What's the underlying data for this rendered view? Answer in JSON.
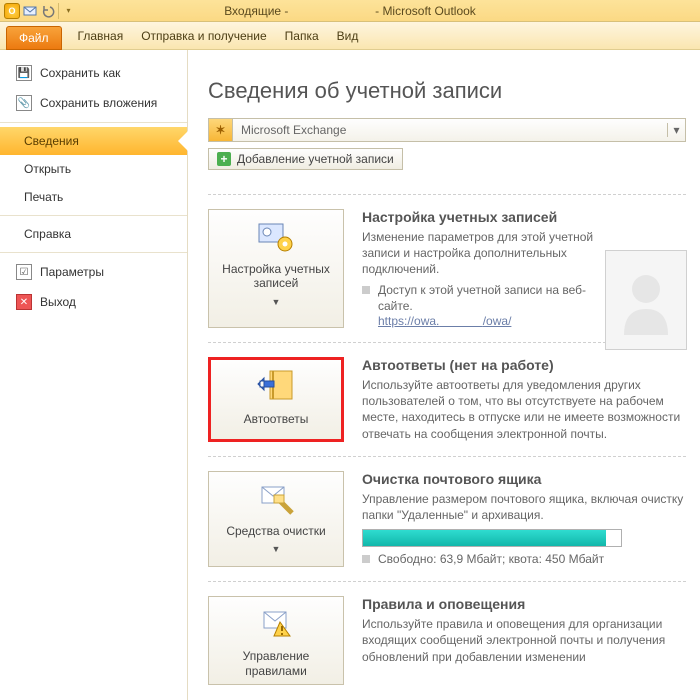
{
  "titlebar": {
    "inbox": "Входящие -",
    "app": "- Microsoft Outlook"
  },
  "tabs": {
    "file": "Файл",
    "home": "Главная",
    "sendrecv": "Отправка и получение",
    "folder": "Папка",
    "view": "Вид"
  },
  "sidebar": {
    "save_as": "Сохранить как",
    "save_attachments": "Сохранить вложения",
    "info": "Сведения",
    "open": "Открыть",
    "print": "Печать",
    "help": "Справка",
    "options": "Параметры",
    "exit": "Выход"
  },
  "content": {
    "heading": "Сведения об учетной записи",
    "account": "Microsoft Exchange",
    "add_account": "Добавление учетной записи",
    "sec1": {
      "button": "Настройка учетных записей",
      "title": "Настройка учетных записей",
      "text": "Изменение параметров для этой учетной записи и настройка дополнительных подключений.",
      "bullet": "Доступ к этой учетной записи на веб-сайте.",
      "link_pre": "https://owa.",
      "link_post": "/owa/"
    },
    "sec2": {
      "button": "Автоответы",
      "title": "Автоответы (нет на работе)",
      "text": "Используйте автоответы для уведомления других пользователей о том, что вы отсутствуете на рабочем месте, находитесь в отпуске или не имеете возможности отвечать на сообщения электронной почты."
    },
    "sec3": {
      "button": "Средства очистки",
      "title": "Очистка почтового ящика",
      "text": "Управление размером почтового ящика, включая очистку папки \"Удаленные\" и архивация.",
      "stats": "Свободно: 63,9 Мбайт; квота: 450 Мбайт"
    },
    "sec4": {
      "button": "Управление правилами",
      "title": "Правила и оповещения",
      "text": "Используйте правила и оповещения для организации входящих сообщений электронной почты и получения обновлений при добавлении изменении"
    }
  }
}
